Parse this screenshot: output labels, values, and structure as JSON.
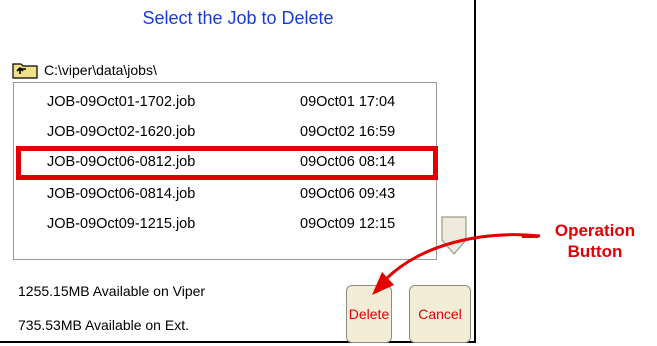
{
  "dialog": {
    "title": "Select the Job to Delete",
    "path": "C:\\viper\\data\\jobs\\",
    "files": [
      {
        "name": "JOB-09Oct01-1702.job",
        "date": "09Oct01 17:04"
      },
      {
        "name": "JOB-09Oct02-1620.job",
        "date": "09Oct02 16:59"
      },
      {
        "name": "JOB-09Oct06-0812.job",
        "date": "09Oct06 08:14"
      },
      {
        "name": "JOB-09Oct06-0814.job",
        "date": "09Oct06 09:43"
      },
      {
        "name": "JOB-09Oct09-1215.job",
        "date": "09Oct09 12:15"
      }
    ],
    "selected_index": 2,
    "status": {
      "viper_available": "1255.15MB Available on Viper",
      "ext_available": "735.53MB Available on Ext."
    },
    "buttons": {
      "delete_label": "Delete",
      "cancel_label": "Cancel"
    }
  },
  "callout": {
    "line1": "Operation",
    "line2": "Button"
  },
  "icons": {
    "folder": "folder-up-icon",
    "scroll": "scroll-down-arrow-icon"
  },
  "colors": {
    "title": "#1a3bd6",
    "highlight": "#e00000",
    "button_text": "#e20000",
    "button_bg": "#f3ecd6"
  }
}
